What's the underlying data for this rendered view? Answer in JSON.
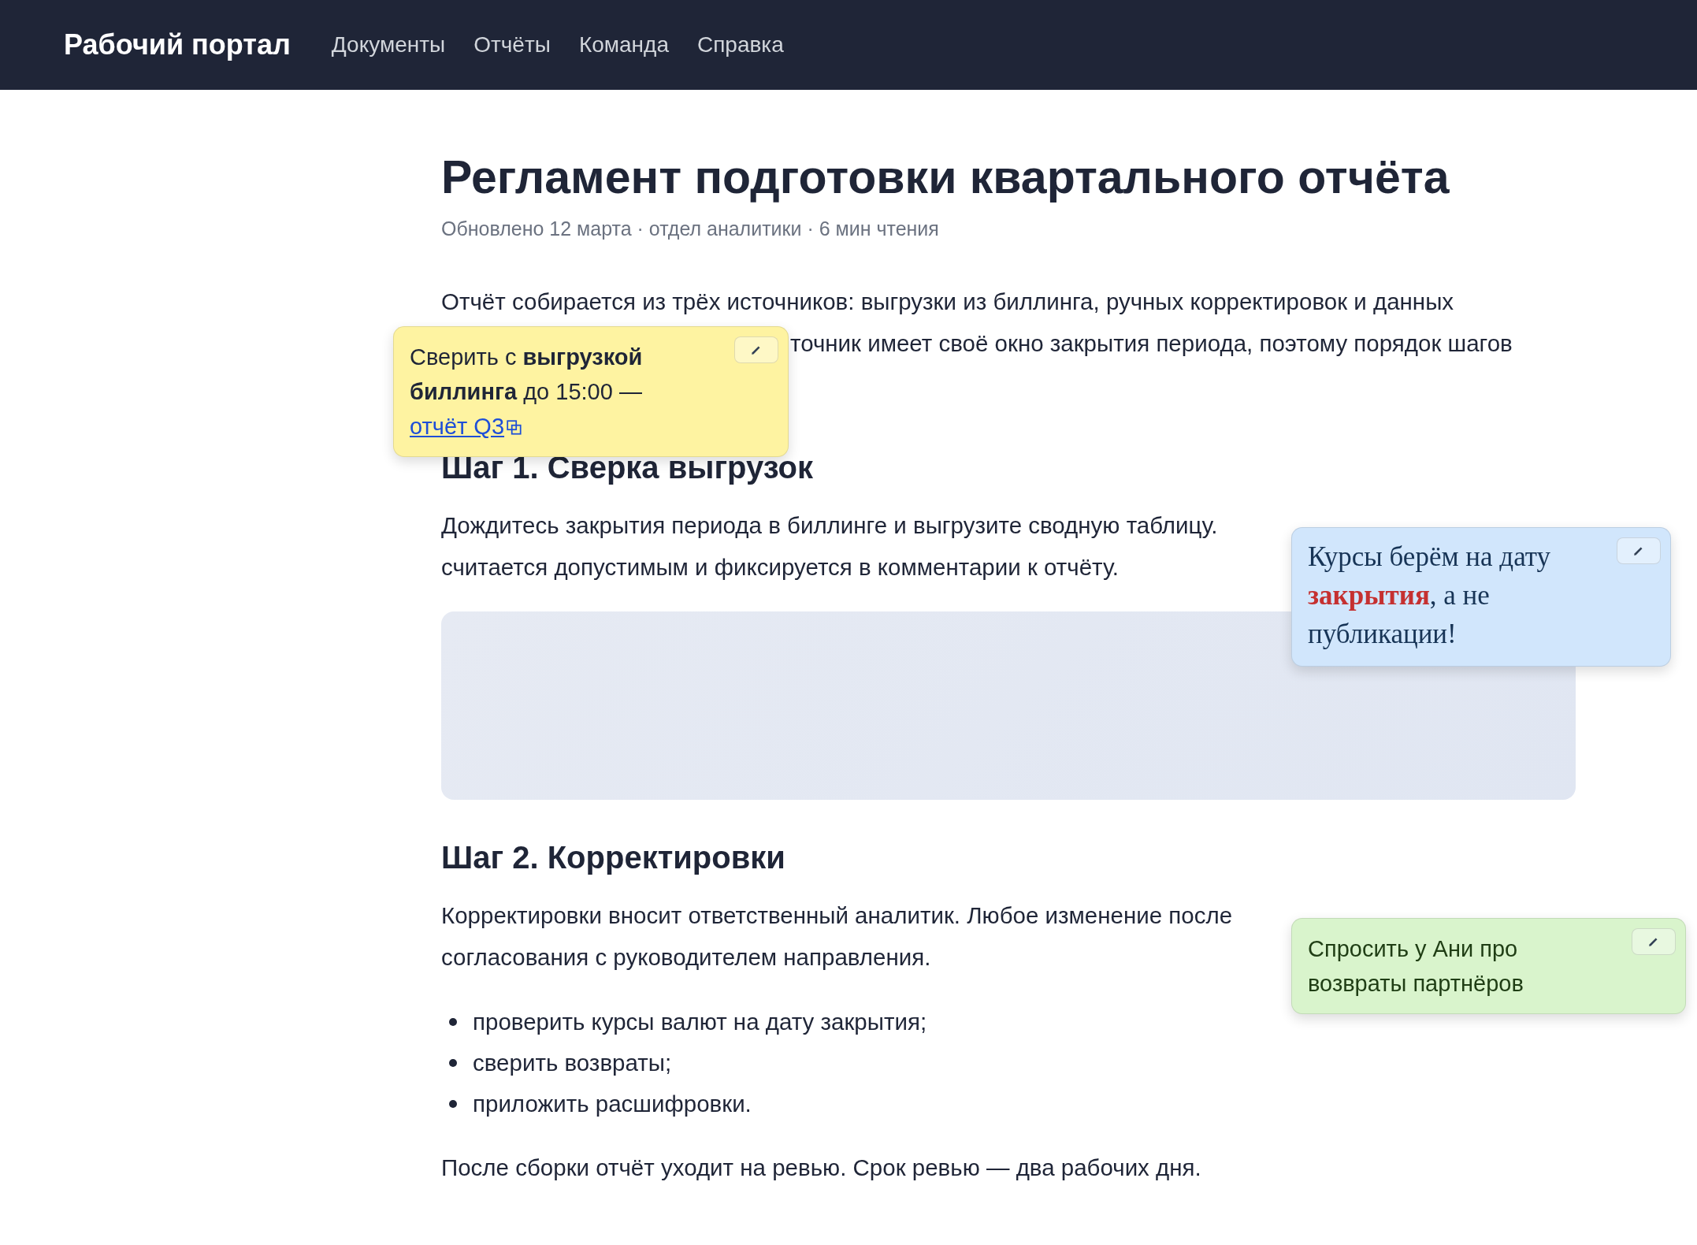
{
  "header": {
    "brand": "Рабочий портал",
    "nav": [
      {
        "label": "Документы"
      },
      {
        "label": "Отчёты"
      },
      {
        "label": "Команда"
      },
      {
        "label": "Справка"
      }
    ]
  },
  "article": {
    "title": "Регламент подготовки квартального отчёта",
    "meta": "Обновлено 12 марта · отдел аналитики · 6 мин чтения",
    "blocks": [
      {
        "kind": "paragraph",
        "lines": [
          {
            "text": "Отчёт собирается из трёх источников: выгрузки из биллинга, ручных корректировок и данных",
            "covered_start": false
          },
          {
            "text": "точник имеет своё окно закрытия периода, поэтому порядок шагов",
            "covered_start": true
          }
        ]
      },
      {
        "kind": "heading",
        "text": "Шаг 1. Сверка выгрузок"
      },
      {
        "kind": "paragraph",
        "lines": [
          {
            "text": "Дождитесь закрытия периода в биллинге и выгрузите сводную таблицу.",
            "covered_start": false
          },
          {
            "text": "считается допустимым и фиксируется в комментарии к отчёту.",
            "covered_start": false
          }
        ]
      },
      {
        "kind": "panel"
      },
      {
        "kind": "heading",
        "text": "Шаг 2. Корректировки"
      },
      {
        "kind": "paragraph",
        "lines": [
          {
            "text": "Корректировки вносит ответственный аналитик. Любое изменение после",
            "covered_start": false
          },
          {
            "text": "согласования с руководителем направления.",
            "covered_start": false
          }
        ]
      },
      {
        "kind": "list",
        "items": [
          "проверить курсы валют на дату закрытия;",
          "сверить возвраты;",
          "приложить расшифровки."
        ]
      },
      {
        "kind": "paragraph",
        "lines": [
          {
            "text": "После сборки отчёт уходит на ревью. Срок ревью — два рабочих дня.",
            "covered_start": false
          }
        ]
      }
    ]
  },
  "notes": [
    {
      "kind": "sans",
      "color": "#fef3a1",
      "text": "Сверить с **выгрузкой биллинга** до 15:00 —",
      "link": "отчёт Q3"
    },
    {
      "kind": "serif",
      "color": "#d1e6fc",
      "text": "Курсы берём на дату **закрытия**, а не публикации!"
    },
    {
      "kind": "sans",
      "color": "#d9f4cc",
      "text": "Спросить у Ани про возвраты партнёров"
    }
  ]
}
